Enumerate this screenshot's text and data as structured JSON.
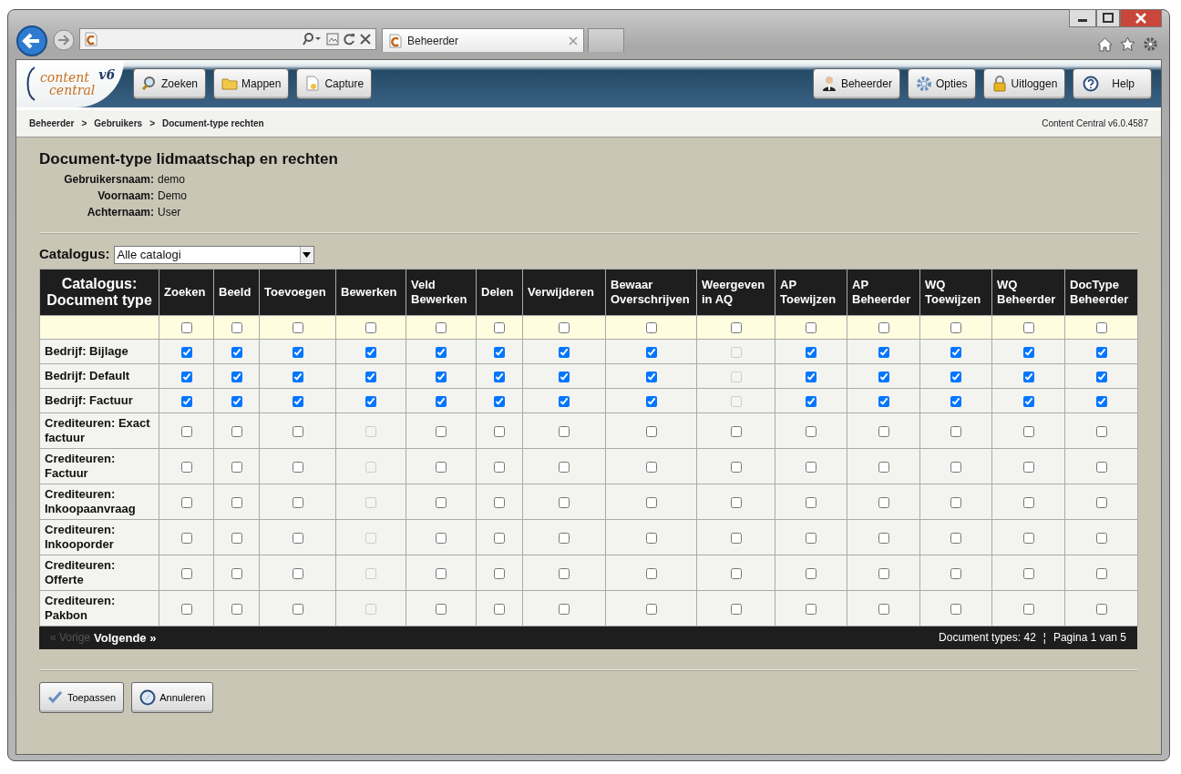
{
  "browser": {
    "tab": {
      "title": "Beheerder"
    }
  },
  "app": {
    "logo": {
      "line1": "content",
      "line2": "central",
      "version": "v6"
    },
    "nav_left": [
      {
        "label": "Zoeken",
        "kind": "search"
      },
      {
        "label": "Mappen",
        "kind": "folder"
      },
      {
        "label": "Capture",
        "kind": "document"
      }
    ],
    "nav_right": [
      {
        "label": "Beheerder",
        "kind": "person"
      },
      {
        "label": "Opties",
        "kind": "gear"
      },
      {
        "label": "Uitloggen",
        "kind": "lock"
      },
      {
        "label": "Help",
        "kind": "help"
      }
    ]
  },
  "breadcrumb": {
    "items": [
      "Beheerder",
      "Gebruikers",
      "Document-type rechten"
    ],
    "separator": ">",
    "version": "Content Central v6.0.4587"
  },
  "page": {
    "title": "Document-type lidmaatschap en rechten",
    "fields": [
      {
        "label": "Gebruikersnaam:",
        "value": "demo"
      },
      {
        "label": "Voornaam:",
        "value": "Demo"
      },
      {
        "label": "Achternaam:",
        "value": "User"
      }
    ],
    "catalog_filter": {
      "label": "Catalogus:",
      "value": "Alle catalogi"
    }
  },
  "table": {
    "columns": [
      "Catalogus: Document type",
      "Zoeken",
      "Beeld",
      "Toevoegen",
      "Bewerken",
      "Veld Bewerken",
      "Delen",
      "Verwijderen",
      "Bewaar Overschrijven",
      "Weergeven in AQ",
      "AP Toewijzen",
      "AP Beheerder",
      "WQ Toewijzen",
      "WQ Beheerder",
      "DocType Beheerder"
    ],
    "select_all": [
      false,
      false,
      false,
      false,
      false,
      false,
      false,
      false,
      false,
      false,
      false,
      false,
      false,
      false
    ],
    "rows": [
      {
        "name": "Bedrijf: Bijlage",
        "checked": [
          true,
          true,
          true,
          true,
          true,
          true,
          true,
          true,
          false,
          true,
          true,
          true,
          true,
          true
        ],
        "disabled": [
          false,
          false,
          false,
          false,
          false,
          false,
          false,
          false,
          true,
          false,
          false,
          false,
          false,
          false
        ]
      },
      {
        "name": "Bedrijf: Default",
        "checked": [
          true,
          true,
          true,
          true,
          true,
          true,
          true,
          true,
          false,
          true,
          true,
          true,
          true,
          true
        ],
        "disabled": [
          false,
          false,
          false,
          false,
          false,
          false,
          false,
          false,
          true,
          false,
          false,
          false,
          false,
          false
        ]
      },
      {
        "name": "Bedrijf: Factuur",
        "checked": [
          true,
          true,
          true,
          true,
          true,
          true,
          true,
          true,
          false,
          true,
          true,
          true,
          true,
          true
        ],
        "disabled": [
          false,
          false,
          false,
          false,
          false,
          false,
          false,
          false,
          true,
          false,
          false,
          false,
          false,
          false
        ]
      },
      {
        "name": "Crediteuren: Exact factuur",
        "checked": [
          false,
          false,
          false,
          false,
          false,
          false,
          false,
          false,
          false,
          false,
          false,
          false,
          false,
          false
        ],
        "disabled": [
          false,
          false,
          false,
          true,
          false,
          false,
          false,
          false,
          false,
          false,
          false,
          false,
          false,
          false
        ]
      },
      {
        "name": "Crediteuren: Factuur",
        "checked": [
          false,
          false,
          false,
          false,
          false,
          false,
          false,
          false,
          false,
          false,
          false,
          false,
          false,
          false
        ],
        "disabled": [
          false,
          false,
          false,
          true,
          false,
          false,
          false,
          false,
          false,
          false,
          false,
          false,
          false,
          false
        ]
      },
      {
        "name": "Crediteuren: Inkoopaanvraag",
        "checked": [
          false,
          false,
          false,
          false,
          false,
          false,
          false,
          false,
          false,
          false,
          false,
          false,
          false,
          false
        ],
        "disabled": [
          false,
          false,
          false,
          true,
          false,
          false,
          false,
          false,
          false,
          false,
          false,
          false,
          false,
          false
        ]
      },
      {
        "name": "Crediteuren: Inkooporder",
        "checked": [
          false,
          false,
          false,
          false,
          false,
          false,
          false,
          false,
          false,
          false,
          false,
          false,
          false,
          false
        ],
        "disabled": [
          false,
          false,
          false,
          true,
          false,
          false,
          false,
          false,
          false,
          false,
          false,
          false,
          false,
          false
        ]
      },
      {
        "name": "Crediteuren: Offerte",
        "checked": [
          false,
          false,
          false,
          false,
          false,
          false,
          false,
          false,
          false,
          false,
          false,
          false,
          false,
          false
        ],
        "disabled": [
          false,
          false,
          false,
          true,
          false,
          false,
          false,
          false,
          false,
          false,
          false,
          false,
          false,
          false
        ]
      },
      {
        "name": "Crediteuren: Pakbon",
        "checked": [
          false,
          false,
          false,
          false,
          false,
          false,
          false,
          false,
          false,
          false,
          false,
          false,
          false,
          false
        ],
        "disabled": [
          false,
          false,
          false,
          true,
          false,
          false,
          false,
          false,
          false,
          false,
          false,
          false,
          false,
          false
        ]
      }
    ]
  },
  "pager": {
    "prev": "« Vorige",
    "prev_disabled": true,
    "next": "Volgende »",
    "count": "Document types: 42",
    "separator": "¦",
    "page": "Pagina 1 van 5"
  },
  "actions": [
    {
      "label": "Toepassen",
      "kind": "check"
    },
    {
      "label": "Annuleren",
      "kind": "compass"
    }
  ]
}
